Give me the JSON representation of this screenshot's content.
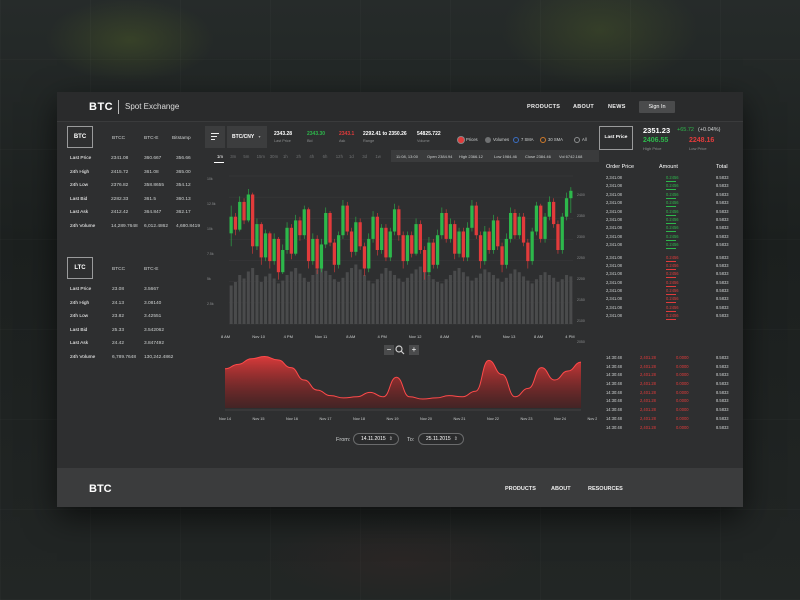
{
  "header": {
    "brand": "BTC",
    "subtitle": "Spot Exchange",
    "nav": [
      "PRODUCTS",
      "ABOUT",
      "NEWS"
    ],
    "signin": "Sign In"
  },
  "btc_table": {
    "badge": "BTC",
    "columns": [
      "BTCC",
      "BTC-E",
      "Bitstamp"
    ],
    "rows": [
      {
        "label": "Last Price",
        "v": [
          "2341.08",
          "360.667",
          "356.66"
        ]
      },
      {
        "label": "24h High",
        "v": [
          "2415.72",
          "361.08",
          "365.00"
        ]
      },
      {
        "label": "24h Low",
        "v": [
          "2376.82",
          "358.8655",
          "354.12"
        ]
      },
      {
        "label": "Last Bid",
        "v": [
          "2282.33",
          "361.5",
          "360.13"
        ]
      },
      {
        "label": "Last Ask",
        "v": [
          "2412.42",
          "364.847",
          "362.17"
        ]
      },
      {
        "label": "24h Volume",
        "v": [
          "14,289.7648",
          "6,012.4862",
          "4,680.8419"
        ]
      }
    ]
  },
  "ltc_table": {
    "badge": "LTC",
    "columns": [
      "BTCC",
      "BTC-E"
    ],
    "rows": [
      {
        "label": "Last Price",
        "v": [
          "23.08",
          "3.5667"
        ]
      },
      {
        "label": "24h High",
        "v": [
          "24.13",
          "3.08140"
        ]
      },
      {
        "label": "24h Low",
        "v": [
          "23.82",
          "3.42551"
        ]
      },
      {
        "label": "Last Bid",
        "v": [
          "25.33",
          "3.542062"
        ]
      },
      {
        "label": "Last Ask",
        "v": [
          "24.42",
          "3.847492"
        ]
      },
      {
        "label": "24h Volume",
        "v": [
          "6,789.7648",
          "130,242.4862"
        ]
      }
    ]
  },
  "toolbar": {
    "pair": "BTC/CNY",
    "last_price": {
      "value": "2343.28",
      "label": "Last Price"
    },
    "bid": {
      "value": "2343.30",
      "label": "Bid"
    },
    "ask": {
      "value": "2343.1",
      "label": "Ask"
    },
    "range": {
      "value": "2292.41 to 2350.26",
      "label": "Range"
    },
    "volume": {
      "value": "54825.722",
      "label": "Volume"
    },
    "legend": [
      "Prices",
      "Volumes",
      "7 SMA",
      "30 SMA",
      "All"
    ],
    "legend_colors": [
      "#e23b3b",
      "#6f7172",
      "#3b6fc4",
      "#d07a2a",
      "#8c8e8f"
    ]
  },
  "last_price_panel": {
    "button": "Last Price",
    "value": "2351.23",
    "change": "+65.72",
    "change_pct": "(+0.04%)",
    "high": "2406.55",
    "high_label": "High Price",
    "low": "2248.16",
    "low_label": "Low Price"
  },
  "timeframes": [
    "1m",
    "3m",
    "5m",
    "15m",
    "30m",
    "1h",
    "2h",
    "4h",
    "6h",
    "12h",
    "1d",
    "3d",
    "1w"
  ],
  "ohlc": {
    "time": "11:08, 13:00",
    "open": "Open 2384.94",
    "high": "High 2366.12",
    "low": "Low 1984.46",
    "close": "Close 2384.46",
    "vol": "Vol 6742.168"
  },
  "colors": {
    "up": "#2db84b",
    "down": "#e23b3b",
    "panel": "#2e2f30"
  },
  "chart_data": [
    {
      "type": "candlestick",
      "x_ticks": [
        "8 AM",
        "Nov 10",
        "4 PM",
        "Nov 11",
        "8 AM",
        "4 PM",
        "Nov 12",
        "8 AM",
        "4 PM",
        "Nov 13",
        "8 AM",
        "4 PM"
      ],
      "y_ticks_left": [
        "10k",
        "12.5k",
        "10k",
        "7.5k",
        "5k",
        "2.5k",
        ""
      ],
      "y_ticks_right": [
        "2400",
        "2350",
        "2300",
        "2250",
        "2200",
        "2150",
        "2100",
        "2050"
      ],
      "ylim": [
        2000,
        2400
      ],
      "candles": [
        [
          2245,
          2290,
          2210,
          2320,
          1
        ],
        [
          2290,
          2255,
          2240,
          2300,
          0
        ],
        [
          2255,
          2330,
          2250,
          2345,
          1
        ],
        [
          2330,
          2280,
          2270,
          2340,
          0
        ],
        [
          2280,
          2350,
          2275,
          2365,
          1
        ],
        [
          2350,
          2210,
          2190,
          2355,
          0
        ],
        [
          2210,
          2270,
          2200,
          2285,
          1
        ],
        [
          2270,
          2180,
          2160,
          2275,
          0
        ],
        [
          2180,
          2245,
          2170,
          2255,
          1
        ],
        [
          2245,
          2170,
          2150,
          2250,
          0
        ],
        [
          2170,
          2230,
          2160,
          2245,
          1
        ],
        [
          2230,
          2140,
          2120,
          2235,
          0
        ],
        [
          2140,
          2200,
          2135,
          2215,
          1
        ],
        [
          2200,
          2260,
          2190,
          2275,
          1
        ],
        [
          2260,
          2190,
          2175,
          2270,
          0
        ],
        [
          2190,
          2280,
          2185,
          2295,
          1
        ],
        [
          2280,
          2240,
          2225,
          2290,
          0
        ],
        [
          2240,
          2310,
          2230,
          2320,
          1
        ],
        [
          2310,
          2170,
          2150,
          2315,
          0
        ],
        [
          2170,
          2230,
          2160,
          2245,
          1
        ],
        [
          2230,
          2150,
          2135,
          2240,
          0
        ],
        [
          2150,
          2215,
          2140,
          2230,
          1
        ],
        [
          2215,
          2300,
          2205,
          2315,
          1
        ],
        [
          2300,
          2220,
          2210,
          2305,
          0
        ],
        [
          2220,
          2160,
          2140,
          2230,
          0
        ],
        [
          2160,
          2240,
          2150,
          2250,
          1
        ],
        [
          2240,
          2320,
          2230,
          2335,
          1
        ],
        [
          2320,
          2250,
          2240,
          2330,
          0
        ],
        [
          2250,
          2195,
          2180,
          2260,
          0
        ],
        [
          2195,
          2275,
          2185,
          2290,
          1
        ],
        [
          2275,
          2210,
          2200,
          2285,
          0
        ],
        [
          2210,
          2150,
          2130,
          2220,
          0
        ],
        [
          2150,
          2230,
          2140,
          2245,
          1
        ],
        [
          2230,
          2290,
          2220,
          2305,
          1
        ],
        [
          2290,
          2200,
          2185,
          2300,
          0
        ],
        [
          2200,
          2260,
          2190,
          2270,
          1
        ],
        [
          2260,
          2180,
          2170,
          2270,
          0
        ],
        [
          2180,
          2250,
          2170,
          2260,
          1
        ],
        [
          2250,
          2310,
          2240,
          2325,
          1
        ],
        [
          2310,
          2240,
          2225,
          2320,
          0
        ],
        [
          2240,
          2170,
          2150,
          2250,
          0
        ],
        [
          2170,
          2240,
          2160,
          2250,
          1
        ],
        [
          2240,
          2190,
          2180,
          2250,
          0
        ],
        [
          2190,
          2270,
          2185,
          2285,
          1
        ],
        [
          2270,
          2200,
          2190,
          2280,
          0
        ],
        [
          2200,
          2140,
          2120,
          2210,
          0
        ],
        [
          2140,
          2220,
          2130,
          2235,
          1
        ],
        [
          2220,
          2160,
          2150,
          2230,
          0
        ],
        [
          2160,
          2240,
          2150,
          2255,
          1
        ],
        [
          2240,
          2300,
          2230,
          2315,
          1
        ],
        [
          2300,
          2230,
          2220,
          2310,
          0
        ],
        [
          2230,
          2270,
          2220,
          2285,
          1
        ],
        [
          2270,
          2190,
          2175,
          2280,
          0
        ],
        [
          2190,
          2250,
          2180,
          2260,
          1
        ],
        [
          2250,
          2180,
          2170,
          2260,
          0
        ],
        [
          2180,
          2260,
          2170,
          2275,
          1
        ],
        [
          2260,
          2320,
          2250,
          2335,
          1
        ],
        [
          2320,
          2240,
          2230,
          2330,
          0
        ],
        [
          2240,
          2170,
          2150,
          2250,
          0
        ],
        [
          2170,
          2250,
          2160,
          2265,
          1
        ],
        [
          2250,
          2200,
          2190,
          2260,
          0
        ],
        [
          2200,
          2280,
          2190,
          2295,
          1
        ],
        [
          2280,
          2210,
          2200,
          2290,
          0
        ],
        [
          2210,
          2160,
          2140,
          2220,
          0
        ],
        [
          2160,
          2230,
          2150,
          2245,
          1
        ],
        [
          2230,
          2300,
          2220,
          2315,
          1
        ],
        [
          2300,
          2240,
          2230,
          2310,
          0
        ],
        [
          2240,
          2290,
          2230,
          2300,
          1
        ],
        [
          2290,
          2220,
          2210,
          2300,
          0
        ],
        [
          2220,
          2170,
          2150,
          2230,
          0
        ],
        [
          2170,
          2250,
          2160,
          2260,
          1
        ],
        [
          2250,
          2320,
          2240,
          2330,
          1
        ],
        [
          2320,
          2230,
          2220,
          2325,
          0
        ],
        [
          2230,
          2290,
          2220,
          2300,
          1
        ],
        [
          2290,
          2330,
          2280,
          2345,
          1
        ],
        [
          2330,
          2270,
          2260,
          2340,
          0
        ],
        [
          2270,
          2200,
          2190,
          2280,
          0
        ],
        [
          2200,
          2290,
          2190,
          2300,
          1
        ],
        [
          2290,
          2340,
          2280,
          2355,
          1
        ],
        [
          2340,
          2360,
          2300,
          2370,
          1
        ]
      ],
      "volume": [
        0.55,
        0.6,
        0.7,
        0.65,
        0.75,
        0.8,
        0.7,
        0.6,
        0.68,
        0.72,
        0.65,
        0.58,
        0.62,
        0.7,
        0.75,
        0.8,
        0.72,
        0.66,
        0.6,
        0.7,
        0.78,
        0.82,
        0.76,
        0.7,
        0.64,
        0.6,
        0.66,
        0.74,
        0.8,
        0.85,
        0.78,
        0.7,
        0.62,
        0.58,
        0.64,
        0.72,
        0.8,
        0.76,
        0.7,
        0.65,
        0.6,
        0.66,
        0.72,
        0.78,
        0.82,
        0.76,
        0.7,
        0.64,
        0.6,
        0.58,
        0.64,
        0.7,
        0.76,
        0.8,
        0.74,
        0.68,
        0.62,
        0.66,
        0.72,
        0.78,
        0.74,
        0.7,
        0.65,
        0.6,
        0.66,
        0.72,
        0.78,
        0.74,
        0.68,
        0.62,
        0.58,
        0.64,
        0.7,
        0.74,
        0.7,
        0.66,
        0.6,
        0.64,
        0.7,
        0.68
      ]
    },
    {
      "type": "area",
      "x_ticks": [
        "Nov 14",
        "Nov 15",
        "Nov 16",
        "Nov 17",
        "Nov 18",
        "Nov 19",
        "Nov 20",
        "Nov 21",
        "Nov 22",
        "Nov 23",
        "Nov 24",
        "Nov 25"
      ],
      "values": [
        0.7,
        0.78,
        0.88,
        0.92,
        0.86,
        0.72,
        0.5,
        0.32,
        0.22,
        0.18,
        0.2,
        0.28,
        0.2,
        0.55,
        0.2,
        0.16,
        0.18,
        0.22,
        0.2,
        0.3,
        0.85,
        0.6,
        0.2,
        0.35,
        0.72,
        0.5,
        0.66,
        0.82
      ]
    }
  ],
  "range": {
    "from_label": "From:",
    "from": "14.11.2015",
    "to_label": "To:",
    "to": "25.11.2015"
  },
  "order_book": {
    "headers": [
      "Order Price",
      "Amount",
      "Total"
    ],
    "asks": [
      {
        "p": "2,341.08",
        "a": "0.2456",
        "t": "8.5833"
      },
      {
        "p": "2,341.08",
        "a": "0.2456",
        "t": "8.5833"
      },
      {
        "p": "2,341.08",
        "a": "0.2456",
        "t": "8.5833"
      },
      {
        "p": "2,341.08",
        "a": "0.2456",
        "t": "8.5833"
      },
      {
        "p": "2,341.08",
        "a": "0.2456",
        "t": "8.5833"
      },
      {
        "p": "2,341.08",
        "a": "0.2456",
        "t": "8.5833"
      },
      {
        "p": "2,341.08",
        "a": "0.2456",
        "t": "8.5833"
      },
      {
        "p": "2,341.08",
        "a": "0.2456",
        "t": "8.5833"
      },
      {
        "p": "2,341.08",
        "a": "0.2456",
        "t": "8.5833"
      }
    ],
    "bids": [
      {
        "p": "2,341.08",
        "a": "0.2456",
        "t": "8.5833"
      },
      {
        "p": "2,341.08",
        "a": "0.2456",
        "t": "8.5833"
      },
      {
        "p": "2,341.08",
        "a": "0.2456",
        "t": "8.5833"
      },
      {
        "p": "2,341.08",
        "a": "0.2456",
        "t": "8.5833"
      },
      {
        "p": "2,341.08",
        "a": "0.2456",
        "t": "8.5833"
      },
      {
        "p": "2,341.08",
        "a": "0.2456",
        "t": "8.5833"
      },
      {
        "p": "2,341.08",
        "a": "0.2456",
        "t": "8.5833"
      },
      {
        "p": "2,341.08",
        "a": "0.2456",
        "t": "8.5833"
      }
    ]
  },
  "trades": [
    {
      "time": "14:30:48",
      "price": "2,401.28",
      "amt": "0.0000",
      "t": "8.5833"
    },
    {
      "time": "14:30:48",
      "price": "2,401.28",
      "amt": "0.0000",
      "t": "8.5833"
    },
    {
      "time": "14:30:48",
      "price": "2,401.28",
      "amt": "0.0000",
      "t": "8.5833"
    },
    {
      "time": "14:30:48",
      "price": "2,401.28",
      "amt": "0.0000",
      "t": "8.5833"
    },
    {
      "time": "14:30:48",
      "price": "2,401.28",
      "amt": "0.0000",
      "t": "8.5833"
    },
    {
      "time": "14:30:48",
      "price": "2,401.28",
      "amt": "0.0000",
      "t": "8.5833"
    },
    {
      "time": "14:30:48",
      "price": "2,401.28",
      "amt": "0.0000",
      "t": "8.5833"
    },
    {
      "time": "14:30:48",
      "price": "2,401.28",
      "amt": "0.0000",
      "t": "8.5833"
    },
    {
      "time": "14:30:48",
      "price": "2,401.28",
      "amt": "0.0000",
      "t": "8.5833"
    }
  ],
  "footer": {
    "brand": "BTC",
    "nav": [
      "PRODUCTS",
      "ABOUT",
      "RESOURCES"
    ]
  },
  "zoom": {
    "minus": "−",
    "plus": "+"
  }
}
